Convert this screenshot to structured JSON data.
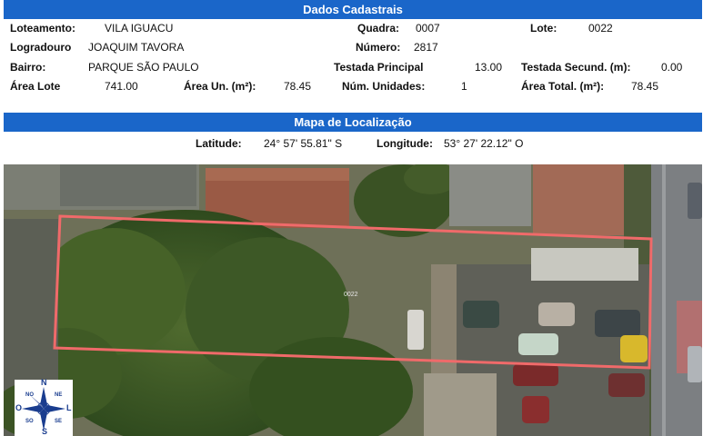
{
  "dados": {
    "title": "Dados Cadastrais",
    "loteamento_label": "Loteamento:",
    "loteamento_value": "VILA IGUACU",
    "quadra_label": "Quadra:",
    "quadra_value": "0007",
    "lote_label": "Lote:",
    "lote_value": "0022",
    "logradouro_label": "Logradouro",
    "logradouro_value": "JOAQUIM TAVORA",
    "numero_label": "Número:",
    "numero_value": "2817",
    "bairro_label": "Bairro:",
    "bairro_value": "PARQUE SÃO PAULO",
    "testada_principal_label": "Testada Principal",
    "testada_principal_value": "13.00",
    "testada_secund_label": "Testada Secund. (m):",
    "testada_secund_value": "0.00",
    "area_lote_label": "Área Lote",
    "area_lote_value": "741.00",
    "area_un_label": "Área Un. (m²):",
    "area_un_value": "78.45",
    "num_unidades_label": "Núm. Unidades:",
    "num_unidades_value": "1",
    "area_total_label": "Área Total. (m²):",
    "area_total_value": "78.45"
  },
  "mapa": {
    "title": "Mapa de Localização",
    "latitude_label": "Latitude:",
    "latitude_value": "24° 57' 55.81\" S",
    "longitude_label": "Longitude:",
    "longitude_value": "53° 27' 22.12\" O",
    "parcel_label": "0022",
    "parcel_color": "#f06a6a",
    "compass": {
      "n": "N",
      "s": "S",
      "e": "L",
      "w": "O",
      "ne": "NE",
      "no": "NO",
      "se": "SE",
      "so": "SO"
    }
  }
}
